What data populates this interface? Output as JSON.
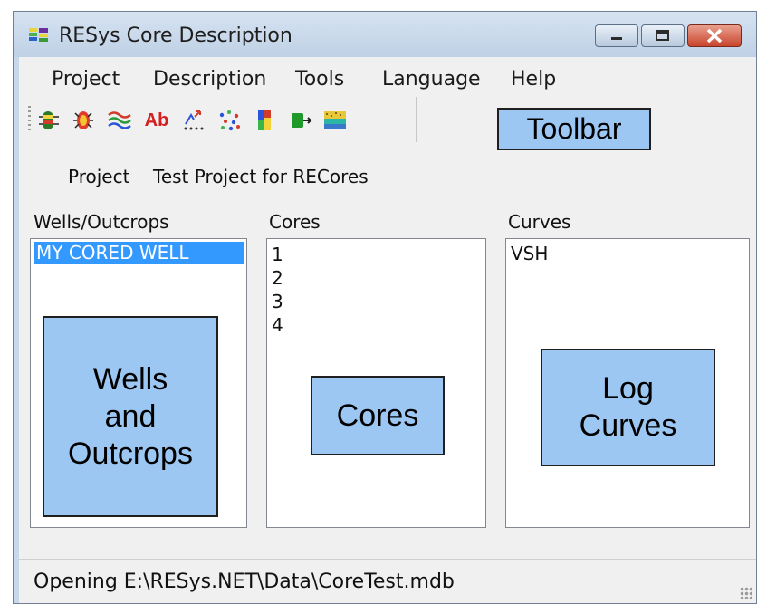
{
  "window": {
    "title": "RESys Core Description"
  },
  "menu": [
    "Project",
    "Description",
    "Tools",
    "Language",
    "Help"
  ],
  "toolbar": {
    "buttons": [
      {
        "icon": "core-bug-icon",
        "glyph": ""
      },
      {
        "icon": "bug-spots-icon",
        "glyph": ""
      },
      {
        "icon": "wavy-lines-icon",
        "glyph": "≈"
      },
      {
        "icon": "text-ab-icon",
        "glyph": "Ab"
      },
      {
        "icon": "scatter-arrows-icon",
        "glyph": ""
      },
      {
        "icon": "dots-icon",
        "glyph": ""
      },
      {
        "icon": "color-bars-icon",
        "glyph": ""
      },
      {
        "icon": "green-export-icon",
        "glyph": ""
      },
      {
        "icon": "texture-icon",
        "glyph": ""
      }
    ]
  },
  "project": {
    "label": "Project",
    "value": "Test Project for RECores"
  },
  "wells": {
    "label": "Wells/Outcrops",
    "items": [
      "MY CORED WELL"
    ],
    "selected_index": 0
  },
  "cores": {
    "label": "Cores",
    "items": [
      "1",
      "2",
      "3",
      "4"
    ]
  },
  "curves": {
    "label": "Curves",
    "items": [
      "VSH"
    ]
  },
  "callouts": {
    "toolbar": "Toolbar",
    "wells": "Wells\nand\nOutcrops",
    "cores": "Cores",
    "curves": "Log\nCurves"
  },
  "status": {
    "text": "Opening E:\\RESys.NET\\Data\\CoreTest.mdb"
  },
  "colors": {
    "callout_fill": "#9cc7f3",
    "selection": "#3399ff"
  }
}
